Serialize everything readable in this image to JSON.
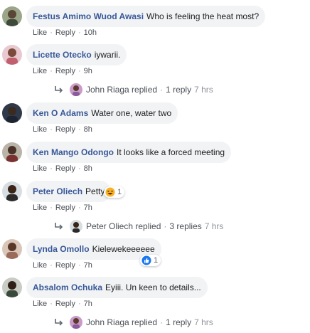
{
  "actions": {
    "like": "Like",
    "reply": "Reply",
    "dot": "·"
  },
  "comments": [
    {
      "author": "Festus Amimo Wuod Awasi",
      "text": "Who is feeling the heat most?",
      "time": "10h"
    },
    {
      "author": "Licette Otecko",
      "text": "iywarii.",
      "time": "9h",
      "reply": {
        "name": "John Riaga replied",
        "count": "1 reply",
        "time": "7 hrs"
      }
    },
    {
      "author": "Ken O Adams",
      "text": "Water one, water two",
      "time": "8h"
    },
    {
      "author": "Ken Mango Odongo",
      "text": "It looks like a forced meeting",
      "time": "8h"
    },
    {
      "author": "Peter Oliech",
      "text": "Petty",
      "time": "7h",
      "reaction": {
        "icon": "haha-emoji-icon",
        "count": "1"
      },
      "reply": {
        "name": "Peter Oliech replied",
        "count": "3 replies",
        "time": "7 hrs"
      }
    },
    {
      "author": "Lynda Omollo",
      "text": "Kielewekeeeeee",
      "time": "7h",
      "reaction": {
        "icon": "like-thumb-icon",
        "count": "1"
      }
    },
    {
      "author": "Absalom Ochuka",
      "text": "Eyiii. Un keen to details...",
      "time": "7h",
      "reply": {
        "name": "John Riaga replied",
        "count": "1 reply",
        "time": "7 hrs"
      }
    }
  ],
  "colors": {
    "author": "#385898",
    "bubble": "#f2f3f5",
    "meta": "#606770",
    "like_blue": "#1877f2",
    "haha_yellow": "#f7b125"
  }
}
